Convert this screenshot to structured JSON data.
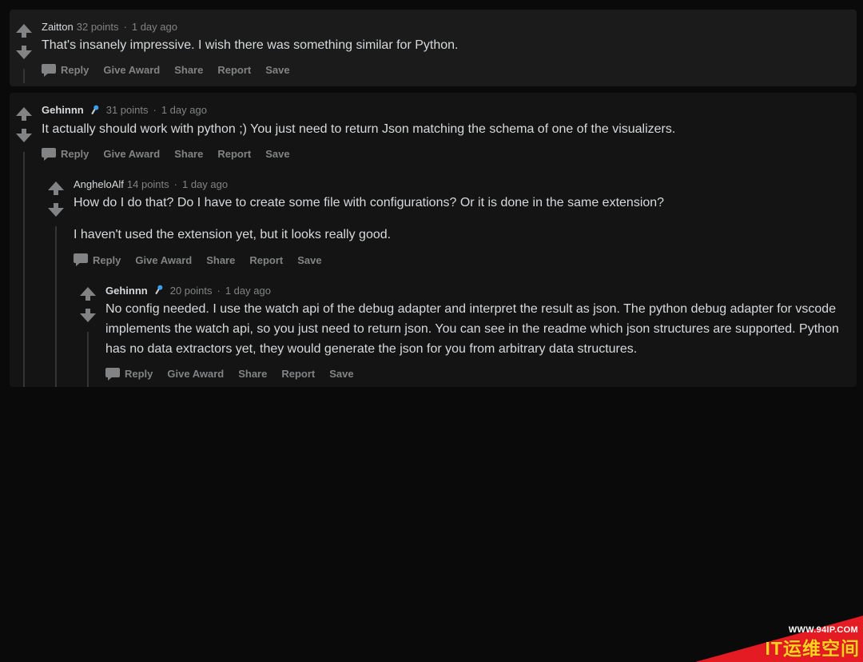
{
  "actions": {
    "reply": "Reply",
    "award": "Give Award",
    "share": "Share",
    "report": "Report",
    "save": "Save"
  },
  "comments": [
    {
      "author": "Zaitton",
      "author_bold": false,
      "mic": false,
      "points": "32 points",
      "age": "1 day ago",
      "paragraphs": [
        "That's insanely impressive. I wish there was something similar for Python."
      ]
    },
    {
      "author": "Gehinnn",
      "author_bold": true,
      "mic": true,
      "points": "31 points",
      "age": "1 day ago",
      "paragraphs": [
        "It actually should work with python ;) You just need to return Json matching the schema of one of the visualizers."
      ]
    },
    {
      "author": "AngheloAlf",
      "author_bold": false,
      "mic": false,
      "points": "14 points",
      "age": "1 day ago",
      "paragraphs": [
        "How do I do that? Do I have to create some file with configurations? Or it is done in the same extension?",
        "I haven't used the extension yet, but it looks really good."
      ]
    },
    {
      "author": "Gehinnn",
      "author_bold": true,
      "mic": true,
      "points": "20 points",
      "age": "1 day ago",
      "paragraphs": [
        "No config needed. I use the watch api of the debug adapter and interpret the result as json. The python debug adapter for vscode implements the watch api, so you just need to return json. You can see in the readme which json structures are supported. Python has no data extractors yet, they would generate the json for you from arbitrary data structures."
      ]
    }
  ],
  "overlay": {
    "small": "WWW.94IP.COM",
    "big": "IT运维空间"
  }
}
